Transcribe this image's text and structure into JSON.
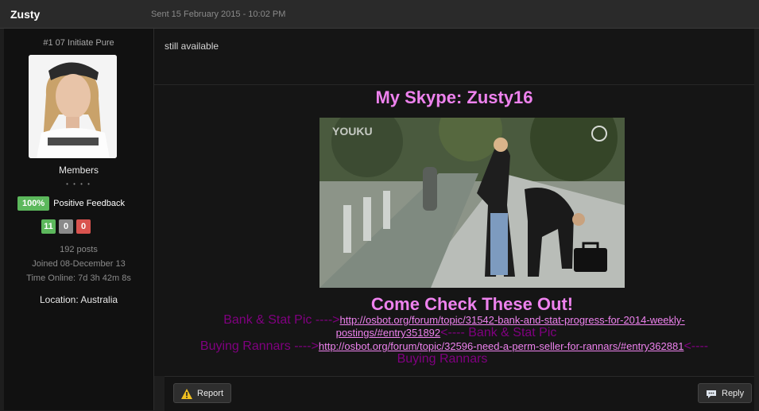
{
  "post": {
    "author": "Zusty",
    "sent": "Sent 15 February 2015 - 10:02 PM",
    "body": "still available"
  },
  "profile": {
    "rank": "#1 07 Initiate Pure",
    "group": "Members",
    "pips": "• • • •",
    "feedback_percent": "100%",
    "feedback_label": "Positive Feedback",
    "feedback_positive": "11",
    "feedback_neutral": "0",
    "feedback_negative": "0",
    "posts": "192 posts",
    "joined": "Joined 08-December 13",
    "time_online": "Time Online: 7d 3h 42m 8s",
    "location": "Location: Australia"
  },
  "signature": {
    "skype": "My Skype: Zusty16",
    "gif_watermark": "YOUKU",
    "heading": "Come Check These Out!",
    "line1_prefix": "Bank & Stat Pic ---->",
    "line1_link_a": "http://osbot.org/forum/topic/31542-bank-and-stat-progress-for-2014-weekly-",
    "line1_link_b": "postings/#entry351892",
    "line1_suffix": "<---- Bank & Stat Pic",
    "line2_prefix": "Buying Rannars ---->",
    "line2_link": "http://osbot.org/forum/topic/32596-need-a-perm-seller-for-rannars/#entry362881",
    "line2_suffix_a": "<----",
    "line2_suffix_b": "Buying Rannars"
  },
  "actions": {
    "report": "Report",
    "reply": "Reply"
  },
  "colors": {
    "signature_pink": "#ee82ee",
    "signature_purple": "#800080",
    "positive": "#5cb85c",
    "neutral": "#8a8a8a",
    "negative": "#d9534f"
  }
}
